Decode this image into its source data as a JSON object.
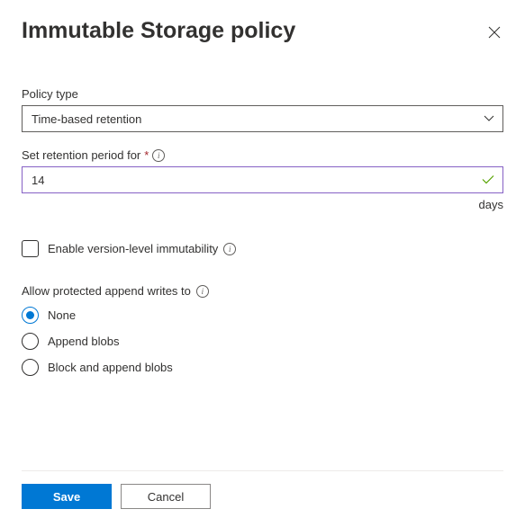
{
  "header": {
    "title": "Immutable Storage policy"
  },
  "policy_type": {
    "label": "Policy type",
    "value": "Time-based retention"
  },
  "retention": {
    "label": "Set retention period for",
    "value": "14",
    "unit": "days"
  },
  "version_level": {
    "label": "Enable version-level immutability"
  },
  "append_writes": {
    "label": "Allow protected append writes to",
    "options": [
      {
        "label": "None"
      },
      {
        "label": "Append blobs"
      },
      {
        "label": "Block and append blobs"
      }
    ]
  },
  "footer": {
    "save": "Save",
    "cancel": "Cancel"
  }
}
